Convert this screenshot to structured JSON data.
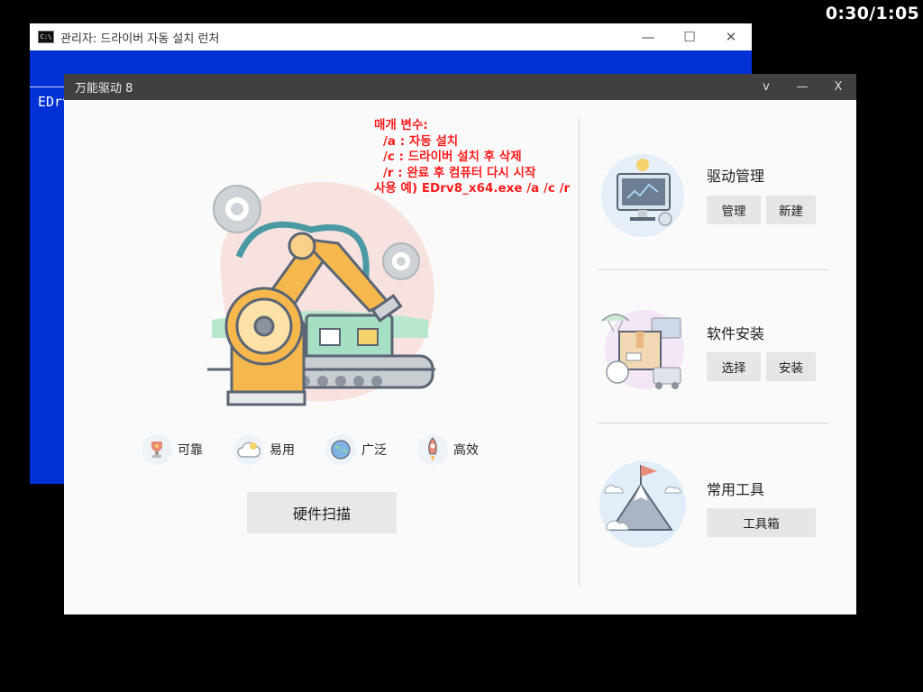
{
  "timer": "0:30/1:05",
  "cmd_window": {
    "title": "관리자:  드라이버 자동 설치 런처",
    "icon_text": "C:\\",
    "text": "EDrv",
    "controls": [
      "—",
      "☐",
      "✕"
    ]
  },
  "app": {
    "title": "万能驱动 8",
    "controls": [
      "v",
      "—",
      "X"
    ],
    "note": {
      "line1": "매개 변수:",
      "line2": "/a : 자동 설치",
      "line3": "/c : 드라이버 설치 후 삭제",
      "line4": "/r : 완료 후 컴퓨터 다시 시작",
      "line5": "사용 예) EDrv8_x64.exe /a /c /r"
    },
    "features": [
      "可靠",
      "易用",
      "广泛",
      "高效"
    ],
    "scan_button": "硬件扫描",
    "sections": {
      "driver": {
        "title": "驱动管理",
        "btn1": "管理",
        "btn2": "新建"
      },
      "software": {
        "title": "软件安装",
        "btn1": "选择",
        "btn2": "安装"
      },
      "tools": {
        "title": "常用工具",
        "btn1": "工具箱"
      }
    }
  },
  "colors": {
    "cmd_bg": "#0031d6",
    "titlebar": "#404040",
    "note": "#ff1a1a",
    "robot": "#f6b84c"
  }
}
